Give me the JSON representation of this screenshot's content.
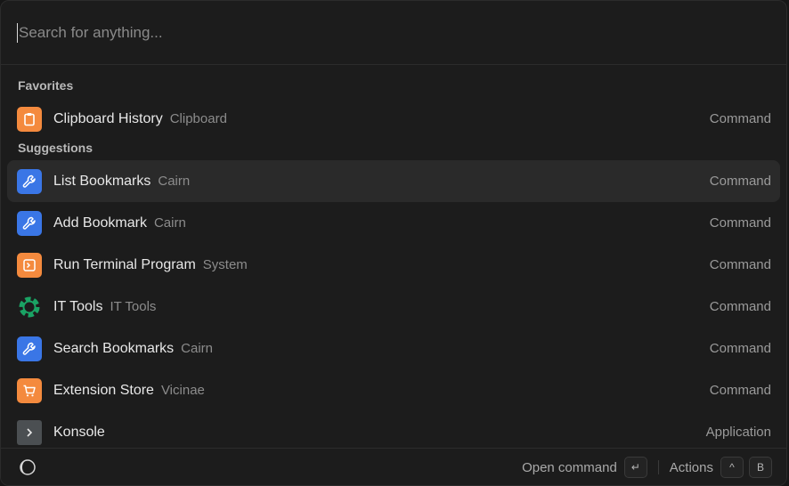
{
  "search": {
    "placeholder": "Search for anything..."
  },
  "favorites": {
    "title": "Favorites",
    "items": [
      {
        "title": "Clipboard History",
        "subtitle": "Clipboard",
        "kind": "Command",
        "icon": "clipboard-icon"
      }
    ]
  },
  "suggestions": {
    "title": "Suggestions",
    "items": [
      {
        "title": "List Bookmarks",
        "subtitle": "Cairn",
        "kind": "Command",
        "icon": "wrench-icon"
      },
      {
        "title": "Add Bookmark",
        "subtitle": "Cairn",
        "kind": "Command",
        "icon": "wrench-icon"
      },
      {
        "title": "Run Terminal Program",
        "subtitle": "System",
        "kind": "Command",
        "icon": "terminal-icon"
      },
      {
        "title": "IT Tools",
        "subtitle": "IT Tools",
        "kind": "Command",
        "icon": "gear-icon"
      },
      {
        "title": "Search Bookmarks",
        "subtitle": "Cairn",
        "kind": "Command",
        "icon": "wrench-icon"
      },
      {
        "title": "Extension Store",
        "subtitle": "Vicinae",
        "kind": "Command",
        "icon": "cart-icon"
      },
      {
        "title": "Konsole",
        "subtitle": "",
        "kind": "Application",
        "icon": "konsole-icon"
      }
    ]
  },
  "footer": {
    "open_label": "Open command",
    "actions_label": "Actions",
    "enter_key": "↵",
    "modifier_key": "^",
    "action_key": "B"
  },
  "colors": {
    "accent_orange": "#f48a3e",
    "accent_blue": "#3a76e6",
    "it_tools_green": "#1aa364"
  }
}
